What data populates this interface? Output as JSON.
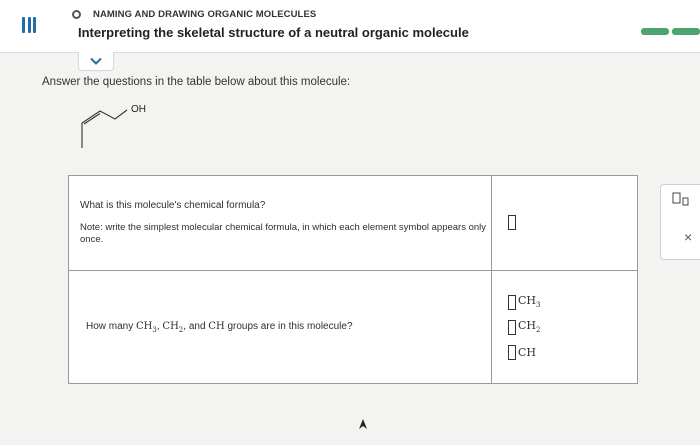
{
  "header": {
    "topic": "NAMING AND DRAWING ORGANIC MOLECULES",
    "title": "Interpreting the skeletal structure of a neutral organic molecule",
    "menu_icon": "hamburger-icon",
    "status_icon": "circle-icon"
  },
  "progress": {
    "segments": 2,
    "color": "#4fa36f"
  },
  "instructions": "Answer the questions in the table below about this molecule:",
  "molecule": {
    "oh_label": "OH"
  },
  "questions": {
    "q1": {
      "text": "What is this molecule's chemical formula?",
      "note": "Note: write the simplest molecular chemical formula, in which each element symbol appears only once."
    },
    "q2": {
      "pre": "How many ",
      "ch3": "CH",
      "ch3_sub": "3",
      "sep1": ", ",
      "ch2": "CH",
      "ch2_sub": "2",
      "sep2": ", and ",
      "ch": "CH",
      "post": " groups are in this molecule?"
    }
  },
  "answers": {
    "groups": [
      {
        "label": "CH",
        "sub": "3"
      },
      {
        "label": "CH",
        "sub": "2"
      },
      {
        "label": "CH",
        "sub": ""
      }
    ]
  },
  "side_panel": {
    "tool_icon": "subscript-template-icon",
    "close": "×"
  },
  "accent_color": "#1d6fa6"
}
